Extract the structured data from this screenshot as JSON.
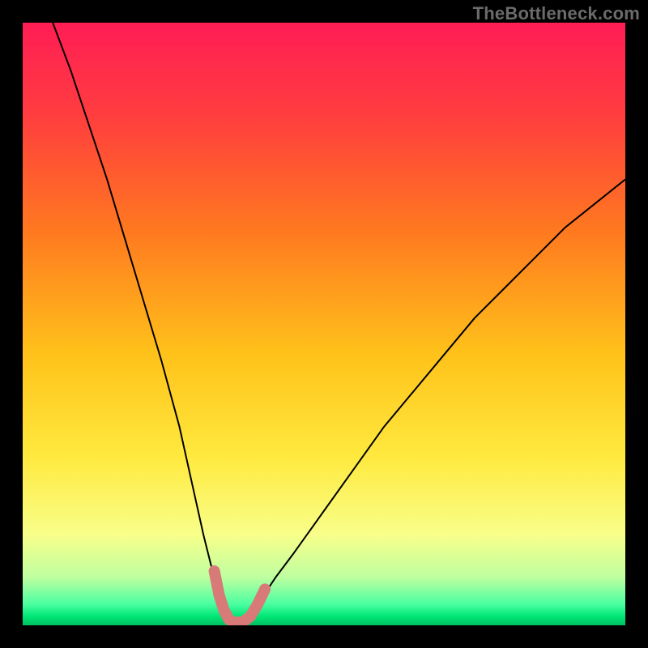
{
  "watermark": "TheBottleneck.com",
  "chart_data": {
    "type": "line",
    "title": "",
    "xlabel": "",
    "ylabel": "",
    "xlim": [
      0,
      100
    ],
    "ylim": [
      0,
      100
    ],
    "grid": false,
    "legend": false,
    "background_gradient": {
      "type": "vertical",
      "stops": [
        {
          "pos": 0.0,
          "color": "#ff1d55"
        },
        {
          "pos": 0.15,
          "color": "#ff3c3f"
        },
        {
          "pos": 0.35,
          "color": "#ff7a1f"
        },
        {
          "pos": 0.55,
          "color": "#ffc21a"
        },
        {
          "pos": 0.72,
          "color": "#ffe93e"
        },
        {
          "pos": 0.85,
          "color": "#f8ff8a"
        },
        {
          "pos": 0.92,
          "color": "#bfffa0"
        },
        {
          "pos": 0.965,
          "color": "#4affa0"
        },
        {
          "pos": 0.985,
          "color": "#00e676"
        },
        {
          "pos": 1.0,
          "color": "#00c060"
        }
      ]
    },
    "series": [
      {
        "name": "bottleneck-curve",
        "color": "#000000",
        "width": 2,
        "x": [
          5,
          8,
          11,
          14,
          17,
          20,
          23,
          26,
          28,
          30,
          31.5,
          33,
          34,
          34.8,
          35.5,
          36.2,
          38,
          40,
          42,
          45,
          50,
          55,
          60,
          65,
          70,
          75,
          80,
          85,
          90,
          95,
          100
        ],
        "y": [
          100,
          92,
          83,
          74,
          64,
          54,
          44,
          33,
          24,
          15,
          9,
          4.5,
          2,
          0.8,
          0.4,
          0.8,
          2.5,
          5,
          8,
          12,
          19,
          26,
          33,
          39,
          45,
          51,
          56,
          61,
          66,
          70,
          74
        ]
      },
      {
        "name": "highlight-band",
        "color": "#d87a78",
        "width": 14,
        "linecap": "round",
        "x": [
          31.8,
          32.6,
          33.4,
          34.2,
          35.0,
          35.8,
          36.6,
          37.8,
          39.0,
          40.2
        ],
        "y": [
          9.0,
          5.0,
          2.5,
          1.0,
          0.5,
          0.5,
          0.6,
          1.5,
          3.5,
          6.0
        ]
      }
    ]
  }
}
